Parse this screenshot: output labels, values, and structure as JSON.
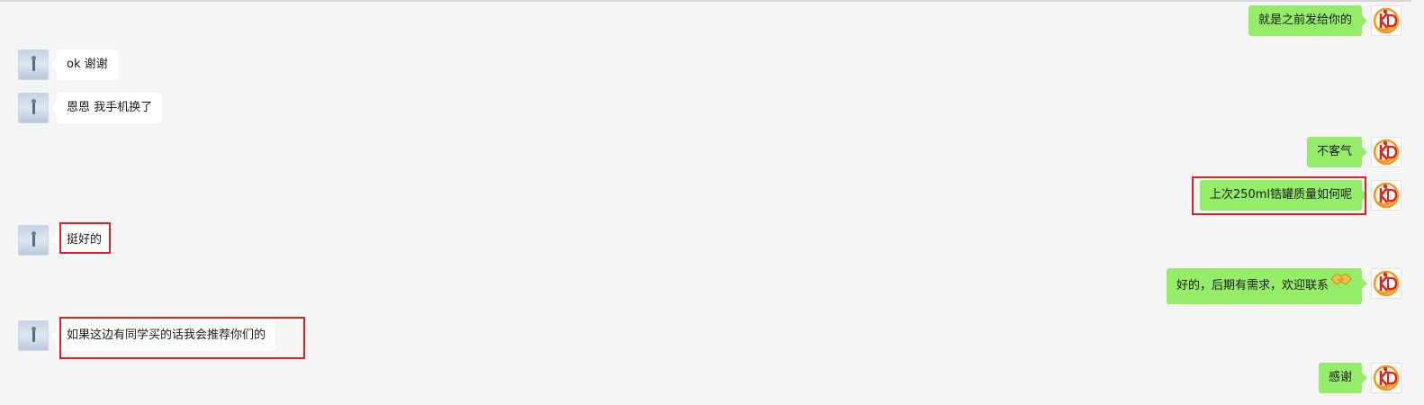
{
  "messages": [
    {
      "side": "out",
      "text": "就是之前发给你的"
    },
    {
      "side": "in",
      "text": "ok 谢谢"
    },
    {
      "side": "in",
      "text": "恩恩 我手机换了"
    },
    {
      "side": "out",
      "text": "不客气"
    },
    {
      "side": "out",
      "text": "上次250ml锆罐质量如何呢",
      "highlighted": true
    },
    {
      "side": "in",
      "text": "挺好的",
      "highlighted": true
    },
    {
      "side": "out",
      "text": "好的，后期有需求，欢迎联系",
      "emoji": "handshake-icon"
    },
    {
      "side": "in",
      "text": "如果这边有同学买的话我会推荐你们的",
      "highlighted": true
    },
    {
      "side": "out",
      "text": "感谢"
    }
  ],
  "colors": {
    "background": "#f5f5f5",
    "incoming_bubble": "#ffffff",
    "outgoing_bubble": "#95ec69",
    "highlight_box": "#e02020",
    "logo_red": "#d9261c",
    "logo_orange": "#f39a1e"
  },
  "avatars": {
    "left": "contact-avatar",
    "right": "kd-logo-avatar"
  }
}
